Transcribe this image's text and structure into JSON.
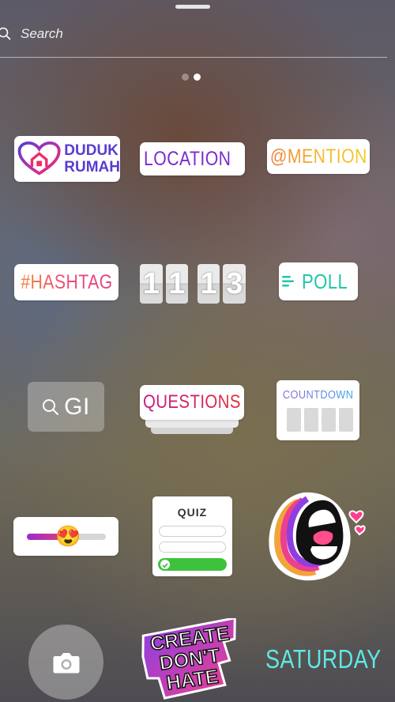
{
  "header": {
    "search_label": "Search"
  },
  "pager": {
    "pages": 2,
    "active_index": 1
  },
  "stickers": {
    "duduk_rumah": {
      "line1": "DUDUK",
      "line2": "RUMAH",
      "icon": "heart-home-icon"
    },
    "location": {
      "label": "LOCATION",
      "icon": "location-pin-icon"
    },
    "mention": {
      "label": "@MENTION"
    },
    "hashtag": {
      "label": "#HASHTAG"
    },
    "time": {
      "hours": "11",
      "minutes": "13"
    },
    "poll": {
      "label": "POLL",
      "icon": "poll-lines-icon"
    },
    "gif": {
      "label": "GI",
      "icon": "search-icon"
    },
    "questions": {
      "label": "QUESTIONS"
    },
    "countdown": {
      "label": "COUNTDOWN"
    },
    "emoji_slider": {
      "emoji": "😍",
      "level": 0.5
    },
    "quiz": {
      "title": "QUIZ"
    },
    "yell": {
      "icon": "mouth-yell-icon"
    },
    "create_dont_hate": {
      "line1": "CREATE",
      "line2": "DON'T",
      "line3": "HATE"
    },
    "saturday": {
      "label": "SATURDAY"
    }
  },
  "camera": {
    "icon": "camera-icon"
  },
  "colors": {
    "location": "#7a2bcf",
    "poll": "#1fc7a9",
    "saturday": "#5fe8e4",
    "quiz_correct": "#3ec23e"
  }
}
